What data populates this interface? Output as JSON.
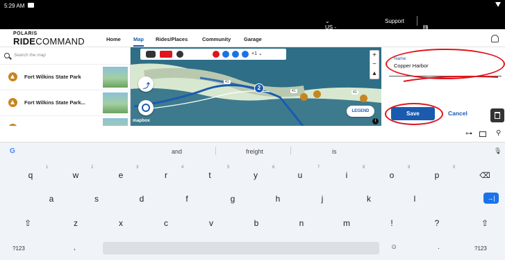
{
  "status_bar": {
    "time": "5:29 AM"
  },
  "top_bar": {
    "language": "US - English",
    "support": "Support",
    "account": "Hi kevinuwa@gmail.com"
  },
  "logo": {
    "top_word": "POLARIS",
    "main_bold": "RIDE",
    "main_light": "COMMAND"
  },
  "nav": {
    "items": [
      "Home",
      "Map",
      "Rides/Places",
      "Community",
      "Garage"
    ],
    "active": "Map"
  },
  "search": {
    "placeholder": "Search the map"
  },
  "places": [
    {
      "name": "Fort Wilkins State Park"
    },
    {
      "name": "Fort Wilkins State Park..."
    }
  ],
  "map": {
    "waypoint_count": "+1",
    "route_marker": "2",
    "road_labels": [
      "41",
      "41",
      "41"
    ],
    "legend": "LEGEND",
    "attribution": "mapbox",
    "zoom_plus": "+",
    "zoom_minus": "−",
    "info": "i",
    "colors": {
      "water": "#2e6e86",
      "land": "#d8e8d0",
      "route": "#1a5bb0"
    }
  },
  "edit_panel": {
    "name_label": "Name",
    "name_value": "Copper Harbor",
    "save": "Save",
    "cancel": "Cancel"
  },
  "keyboard": {
    "suggestions": [
      "and",
      "freight",
      "is"
    ],
    "row1": [
      "q",
      "w",
      "e",
      "r",
      "t",
      "y",
      "u",
      "i",
      "o",
      "p"
    ],
    "row1_hints": [
      "1",
      "2",
      "3",
      "4",
      "5",
      "6",
      "7",
      "8",
      "9",
      "0"
    ],
    "row2": [
      "a",
      "s",
      "d",
      "f",
      "g",
      "h",
      "j",
      "k",
      "l"
    ],
    "row3": [
      "z",
      "x",
      "c",
      "v",
      "b",
      "n",
      "m",
      "!",
      "?"
    ],
    "bottom": {
      "symbols_left": "?123",
      "comma": ",",
      "period": ".",
      "symbols_right": "?123"
    }
  },
  "annotation_color": "#e0141c"
}
